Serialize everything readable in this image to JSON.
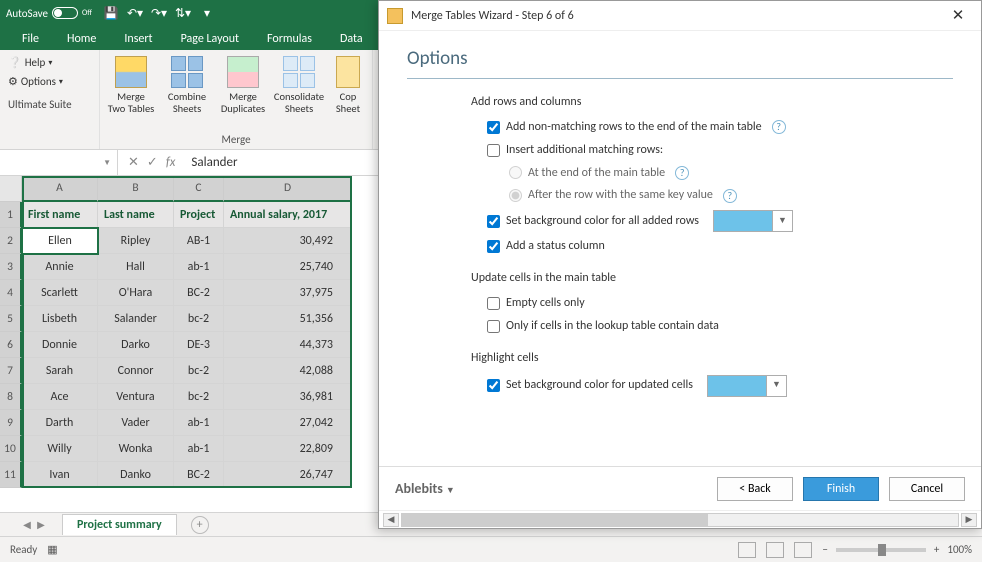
{
  "titlebar": {
    "autosave_label": "AutoSave",
    "autosave_state": "Off"
  },
  "ribbon_tabs": [
    "File",
    "Home",
    "Insert",
    "Page Layout",
    "Formulas",
    "Data"
  ],
  "ribbon_left": {
    "help": "Help",
    "options": "Options",
    "suite": "Ultimate Suite"
  },
  "merge_group": {
    "name": "Merge",
    "buttons": [
      {
        "l1": "Merge",
        "l2": "Two Tables"
      },
      {
        "l1": "Combine",
        "l2": "Sheets"
      },
      {
        "l1": "Merge",
        "l2": "Duplicates"
      },
      {
        "l1": "Consolidate",
        "l2": "Sheets"
      },
      {
        "l1": "Cop",
        "l2": "Sheet"
      }
    ]
  },
  "namebox": "",
  "formula": "Salander",
  "columns": [
    "A",
    "B",
    "C",
    "D"
  ],
  "headers": [
    "First name",
    "Last name",
    "Project",
    "Annual salary, 2017"
  ],
  "rows": [
    [
      "Ellen",
      "Ripley",
      "AB-1",
      "30,492"
    ],
    [
      "Annie",
      "Hall",
      "ab-1",
      "25,740"
    ],
    [
      "Scarlett",
      "O'Hara",
      "BC-2",
      "37,975"
    ],
    [
      "Lisbeth",
      "Salander",
      "bc-2",
      "51,356"
    ],
    [
      "Donnie",
      "Darko",
      "DE-3",
      "44,373"
    ],
    [
      "Sarah",
      "Connor",
      "bc-2",
      "42,088"
    ],
    [
      "Ace",
      "Ventura",
      "bc-2",
      "36,981"
    ],
    [
      "Darth",
      "Vader",
      "ab-1",
      "27,042"
    ],
    [
      "Willy",
      "Wonka",
      "ab-1",
      "22,809"
    ],
    [
      "Ivan",
      "Danko",
      "BC-2",
      "26,747"
    ]
  ],
  "sheet_tab": "Project summary",
  "status": {
    "ready": "Ready",
    "zoom": "100%"
  },
  "dialog": {
    "title": "Merge Tables Wizard - Step 6 of 6",
    "heading": "Options",
    "s1": {
      "title": "Add rows and columns",
      "o1": "Add non-matching rows to the end of the main table",
      "o2": "Insert additional matching rows:",
      "o2a": "At the end of the main table",
      "o2b": "After the row with the same key value",
      "o3": "Set background color for all added rows",
      "o4": "Add a status column"
    },
    "s2": {
      "title": "Update cells in the main table",
      "o1": "Empty cells only",
      "o2": "Only if cells in the lookup table contain data"
    },
    "s3": {
      "title": "Highlight cells",
      "o1": "Set background color for updated cells"
    },
    "brand": "Ablebits",
    "back": "<  Back",
    "finish": "Finish",
    "cancel": "Cancel"
  }
}
